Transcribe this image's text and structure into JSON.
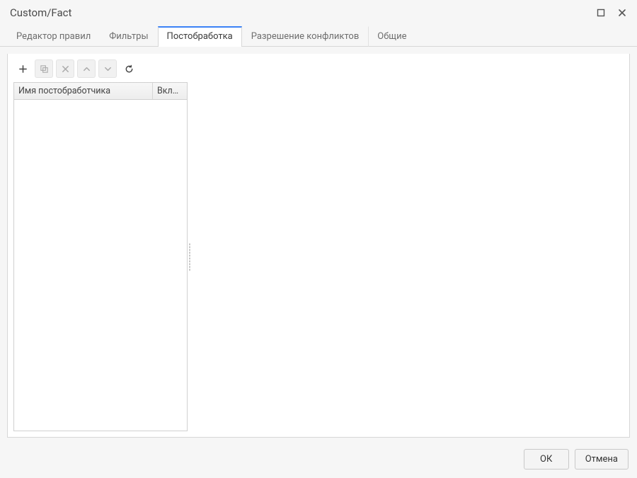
{
  "window": {
    "title": "Custom/Fact"
  },
  "tabs": [
    {
      "label": "Редактор правил",
      "active": false
    },
    {
      "label": "Фильтры",
      "active": false
    },
    {
      "label": "Постобработка",
      "active": true
    },
    {
      "label": "Разрешение конфликтов",
      "active": false
    },
    {
      "label": "Общие",
      "active": false
    }
  ],
  "toolbar": {
    "add_icon": "plus",
    "duplicate_icon": "copy",
    "delete_icon": "x",
    "move_up_icon": "chevron-up",
    "move_down_icon": "chevron-down",
    "reload_icon": "reload"
  },
  "grid": {
    "columns": {
      "name": "Имя постобработчика",
      "enabled": "Вкл…"
    },
    "rows": []
  },
  "footer": {
    "ok": "ОК",
    "cancel": "Отмена"
  }
}
